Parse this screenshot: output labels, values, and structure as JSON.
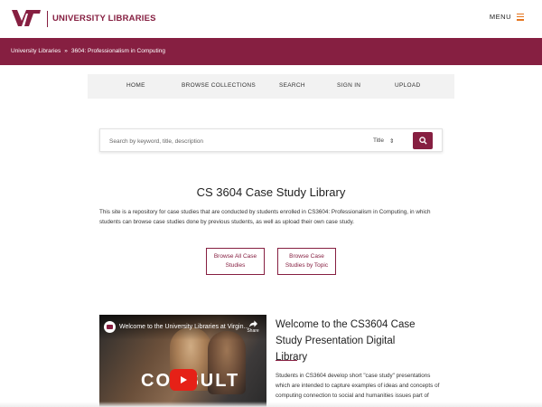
{
  "header": {
    "brand": "UNIVERSITY LIBRARIES",
    "menu_label": "MENU",
    "logo_icon": "vt-logo-icon",
    "brand_color": "#861f41",
    "accent_color": "#e5751f"
  },
  "breadcrumb": {
    "items": [
      "University Libraries",
      "3604: Professionalism in Computing"
    ],
    "separator": "»"
  },
  "nav": {
    "items": [
      "HOME",
      "BROWSE COLLECTIONS",
      "SEARCH",
      "SIGN IN",
      "UPLOAD"
    ]
  },
  "search": {
    "placeholder": "Search by keyword, title, description",
    "select_value": "Title",
    "button_icon": "search-icon"
  },
  "main": {
    "title": "CS 3604 Case Study Library",
    "description": "This site is a repository for case studies that are conducted by students enrolled in CS3604: Professionalism in Computing, in which students can browse case studies done by previous students, as well as upload their own case study.",
    "buttons": [
      "Browse All Case Studies",
      "Browse Case Studies by Topic"
    ]
  },
  "video": {
    "title": "Welcome to the University Libraries at Virgin...",
    "share_label": "Share",
    "overlay_text": "CONSULT",
    "play_icon": "play-icon"
  },
  "welcome": {
    "title": "Welcome to the CS3604 Case Study Presentation Digital Library",
    "body": "Students in CS3604 develop short \"case study\" presentations which are intended to capture examples of ideas and concepts of computing connection to social and humanities issues part of"
  }
}
